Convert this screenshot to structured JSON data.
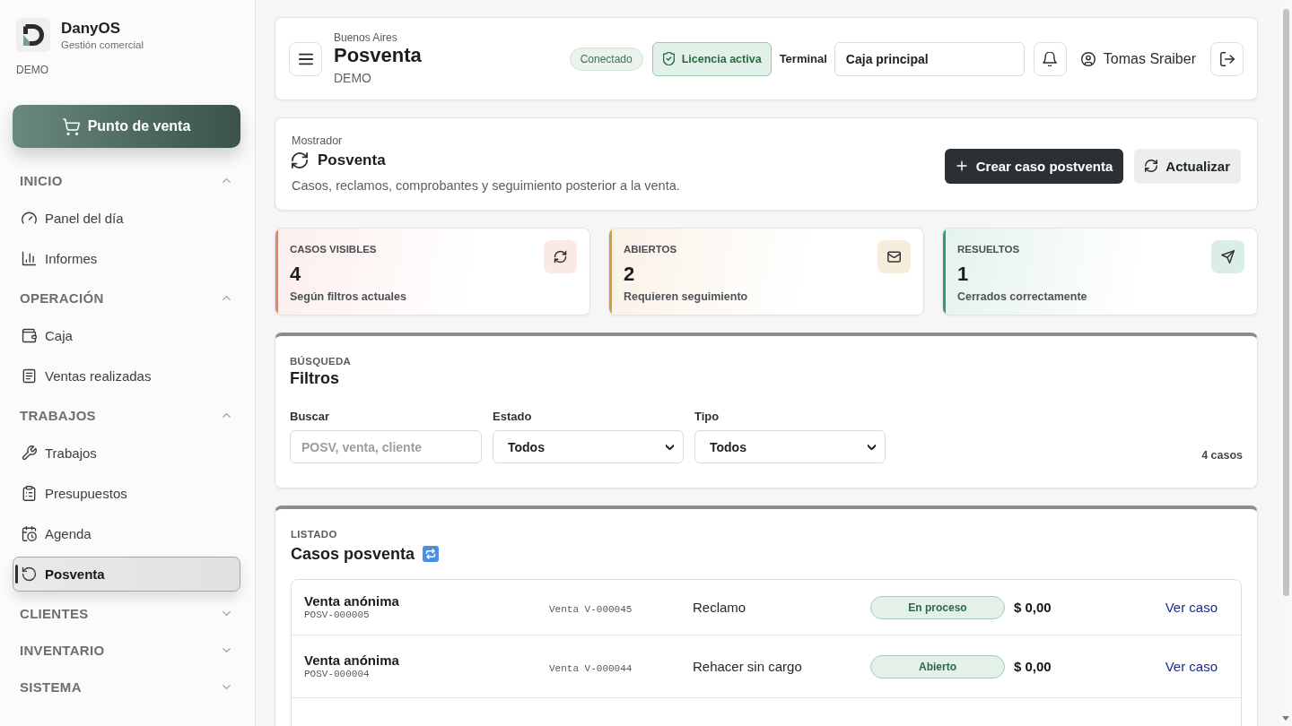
{
  "sidebar": {
    "brand": {
      "name": "DanyOS",
      "subtitle": "Gestión comercial",
      "env": "DEMO"
    },
    "pos_button": {
      "label": "Punto de venta"
    },
    "sections": [
      {
        "title": "INICIO",
        "expanded": true,
        "items": [
          {
            "label": "Panel del día",
            "selected": false
          },
          {
            "label": "Informes",
            "selected": false
          }
        ]
      },
      {
        "title": "OPERACIÓN",
        "expanded": true,
        "items": [
          {
            "label": "Caja",
            "selected": false
          },
          {
            "label": "Ventas realizadas",
            "selected": false
          }
        ]
      },
      {
        "title": "TRABAJOS",
        "expanded": true,
        "items": [
          {
            "label": "Trabajos",
            "selected": false
          },
          {
            "label": "Presupuestos",
            "selected": false
          },
          {
            "label": "Agenda",
            "selected": false
          },
          {
            "label": "Posventa",
            "selected": true
          }
        ]
      },
      {
        "title": "CLIENTES",
        "expanded": false
      },
      {
        "title": "INVENTARIO",
        "expanded": false
      },
      {
        "title": "SISTEMA",
        "expanded": false
      }
    ]
  },
  "topbar": {
    "location": "Buenos Aires",
    "title": "Posventa",
    "env": "DEMO",
    "connection": "Conectado",
    "license": "Licencia activa",
    "terminal_label": "Terminal",
    "terminal_value": "Caja principal",
    "user": "Tomas Sraiber"
  },
  "page_header": {
    "eyebrow": "Mostrador",
    "title": "Posventa",
    "description": "Casos, reclamos, comprobantes y seguimiento posterior a la venta.",
    "buttons": [
      {
        "label": "Crear caso postventa",
        "kind": "primary"
      },
      {
        "label": "Actualizar",
        "kind": "secondary"
      }
    ]
  },
  "stats": [
    {
      "label": "CASOS VISIBLES",
      "value": "4",
      "note": "Según filtros actuales",
      "color": "#e8836c"
    },
    {
      "label": "ABIERTOS",
      "value": "2",
      "note": "Requieren seguimiento",
      "color": "#d9993f"
    },
    {
      "label": "RESUELTOS",
      "value": "1",
      "note": "Cerrados correctamente",
      "color": "#2f9d72"
    }
  ],
  "filters": {
    "eyebrow": "BÚSQUEDA",
    "title": "Filtros",
    "fields": [
      {
        "label": "Buscar",
        "kind": "text",
        "placeholder": "POSV, venta, cliente"
      },
      {
        "label": "Estado",
        "kind": "select",
        "value": "Todos"
      },
      {
        "label": "Tipo",
        "kind": "select",
        "value": "Todos"
      }
    ],
    "count": "4 casos"
  },
  "cases": {
    "eyebrow": "LISTADO",
    "title": "Casos posventa",
    "rows": [
      {
        "customer": "Venta anónima",
        "code": "POSV-000005",
        "sale": "Venta V-000045",
        "type": "Reclamo",
        "status": "En proceso",
        "amount": "$ 0,00",
        "link": "Ver caso"
      },
      {
        "customer": "Venta anónima",
        "code": "POSV-000004",
        "sale": "Venta V-000044",
        "type": "Rehacer sin cargo",
        "status": "Abierto",
        "amount": "$ 0,00",
        "link": "Ver caso"
      }
    ]
  }
}
